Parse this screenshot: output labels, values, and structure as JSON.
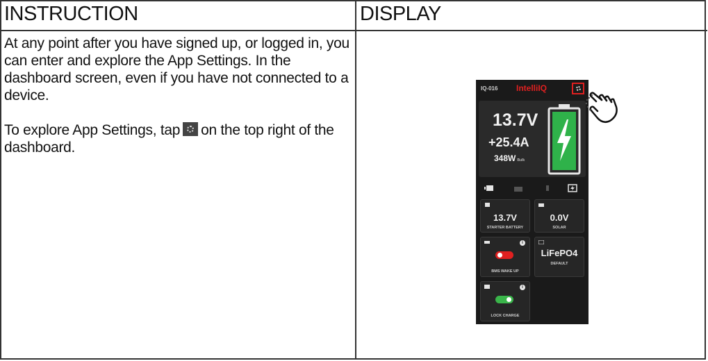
{
  "table": {
    "header_left": "INSTRUCTION",
    "header_right": "DISPLAY"
  },
  "instruction": {
    "paragraph_1": "At any point after you have signed up, or logged in, you can enter and explore the App Settings. In the dashboard screen, even if you have not connected to a device.",
    "paragraph_2_before": "To explore App Settings, tap",
    "paragraph_2_after": "on the top right of the dashboard."
  },
  "phone": {
    "device_id": "IQ-016",
    "brand": "IntelliIQ",
    "voltage": "13.7V",
    "current": "+25.4A",
    "power": "348W",
    "power_mode": "Bulk",
    "tiles": [
      {
        "value": "13.7V",
        "label": "STARTER BATTERY"
      },
      {
        "value": "0.0V",
        "label": "SOLAR"
      },
      {
        "label": "BMS WAKE UP",
        "toggle": "off"
      },
      {
        "value": "LiFePO4",
        "label": "DEFAULT"
      },
      {
        "label": "LOCK CHARGE",
        "toggle": "on"
      }
    ],
    "colors": {
      "accent_red": "#e02020",
      "battery_green": "#2fb24a",
      "toggle_off": "#e02020",
      "toggle_on": "#3ab54a"
    }
  },
  "icons": {
    "settings": "gear-icon",
    "tap": "hand-pointer-icon",
    "battery": "battery-charging-icon"
  }
}
